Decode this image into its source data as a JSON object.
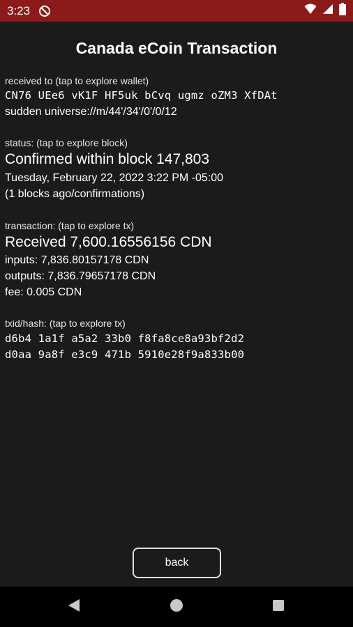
{
  "status_bar": {
    "time": "3:23",
    "icons": [
      "notification-blocked-icon",
      "wifi-icon",
      "cellular-signal-icon",
      "battery-icon"
    ],
    "background_color": "#8c1a1a"
  },
  "page_title": "Canada eCoin Transaction",
  "received_section": {
    "label": "received to (tap to explore wallet)",
    "address": "CN76 UEe6 vK1F HF5uk bCvq ugmz oZM3 XfDAt",
    "path": "sudden universe://m/44'/34'/0'/0/12"
  },
  "status_section": {
    "label": "status: (tap to explore block)",
    "headline": "Confirmed within block 147,803",
    "datetime": "Tuesday, February 22, 2022 3:22 PM -05:00",
    "confirmations": "(1 blocks ago/confirmations)"
  },
  "transaction_section": {
    "label": "transaction: (tap to explore tx)",
    "headline": "Received 7,600.16556156 CDN",
    "inputs": "inputs: 7,836.80157178 CDN",
    "outputs": "outputs: 7,836.79657178 CDN",
    "fee": "fee: 0.005 CDN"
  },
  "hash_section": {
    "label": "txid/hash: (tap to explore tx)",
    "line1": "d6b4 1a1f a5a2 33b0 f8fa8ce8a93bf2d2",
    "line2": "d0aa 9a8f e3c9 471b 5910e28f9a833b00"
  },
  "back_button_label": "back",
  "nav_bar": {
    "icons": [
      "back-triangle-icon",
      "home-circle-icon",
      "recents-square-icon"
    ]
  }
}
